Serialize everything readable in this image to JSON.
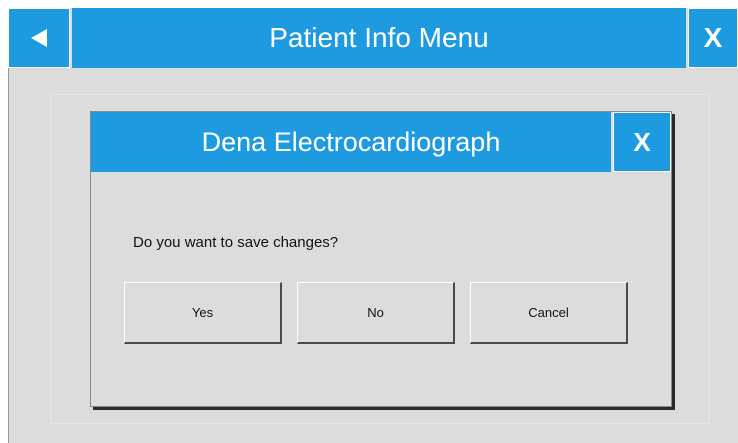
{
  "topbar": {
    "title": "Patient Info Menu",
    "back_icon": "back-arrow-icon",
    "close_label": "X"
  },
  "dialog": {
    "title": "Dena Electrocardiograph",
    "close_label": "X",
    "message": "Do you want to save changes?",
    "buttons": {
      "yes": "Yes",
      "no": "No",
      "cancel": "Cancel"
    }
  },
  "colors": {
    "accent": "#1e9be0",
    "background": "#dcdcdc"
  }
}
